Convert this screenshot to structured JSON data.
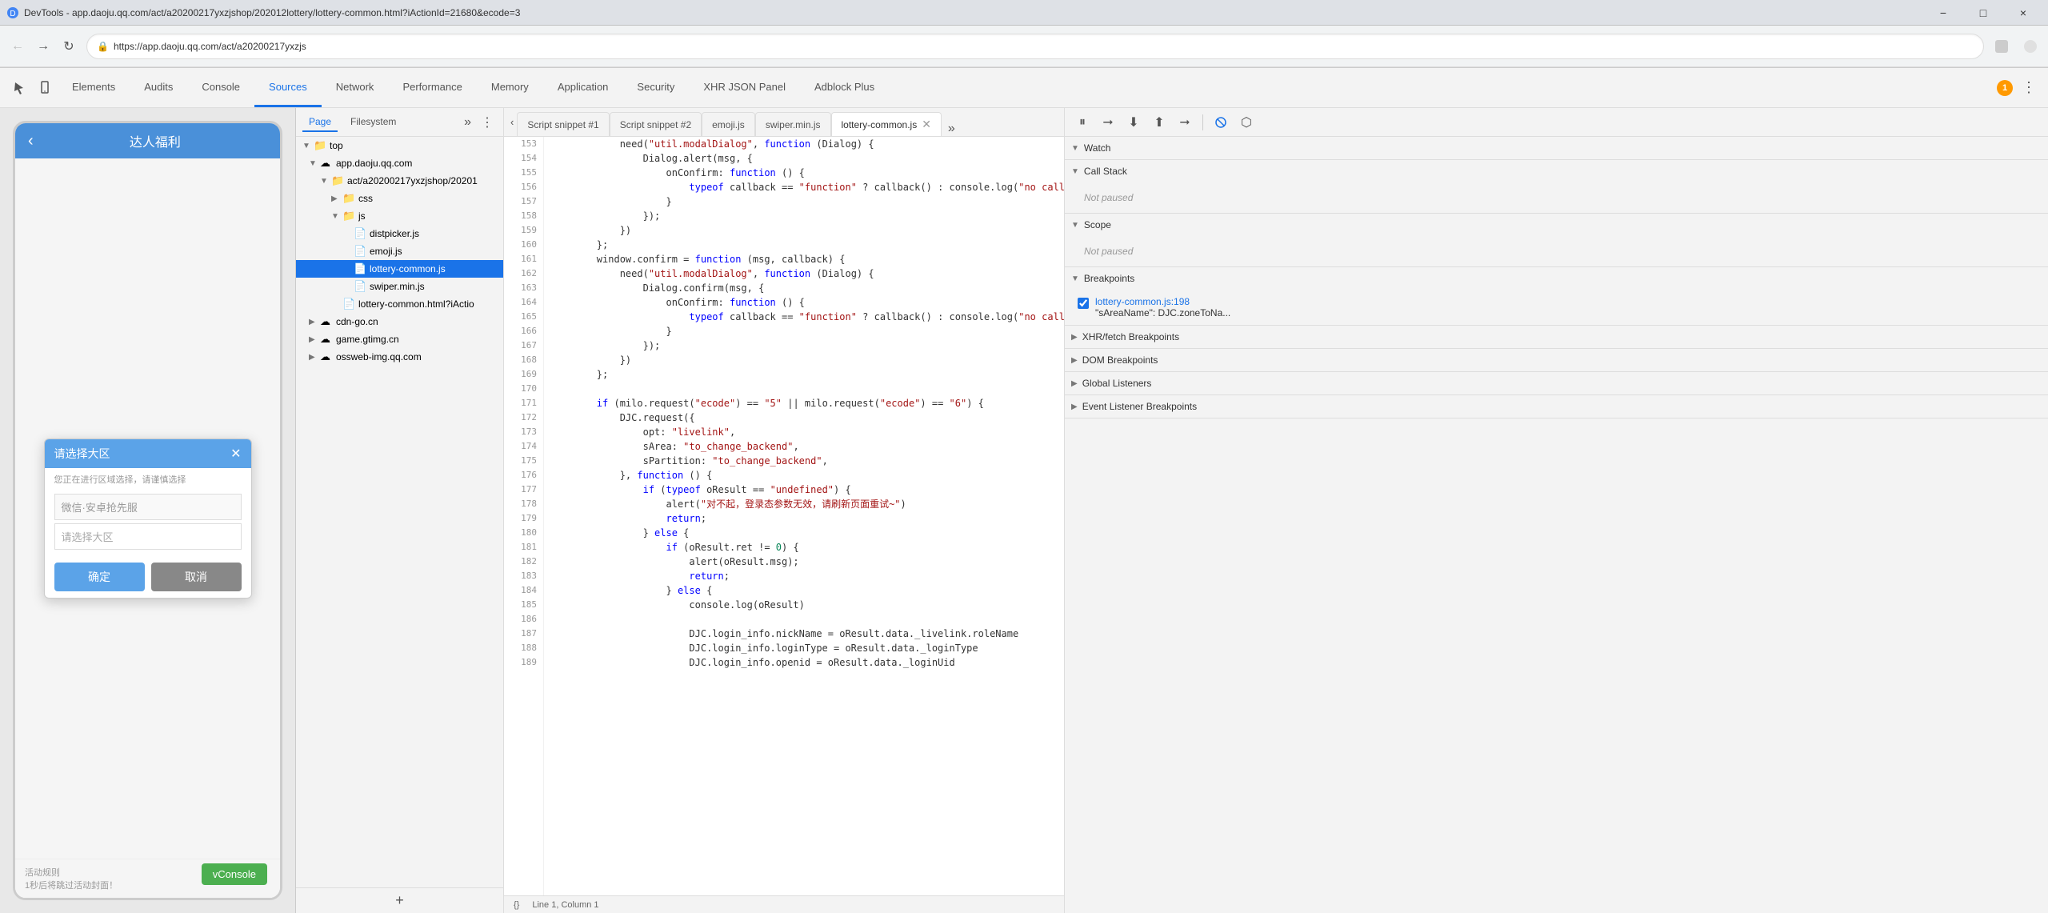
{
  "titlebar": {
    "title": "DevTools - app.daoju.qq.com/act/a20200217yxzjshop/202012lottery/lottery-common.html?iActionId=21680&ecode=3",
    "min": "−",
    "max": "□",
    "close": "×"
  },
  "browser": {
    "url": "https://app.daoju.qq.com/act/a20200217yxzjs",
    "lock_icon": "🔒"
  },
  "devtools": {
    "tabs": [
      {
        "label": "Elements",
        "active": false
      },
      {
        "label": "Audits",
        "active": false
      },
      {
        "label": "Console",
        "active": false
      },
      {
        "label": "Sources",
        "active": true
      },
      {
        "label": "Network",
        "active": false
      },
      {
        "label": "Performance",
        "active": false
      },
      {
        "label": "Memory",
        "active": false
      },
      {
        "label": "Application",
        "active": false
      },
      {
        "label": "Security",
        "active": false
      },
      {
        "label": "XHR JSON Panel",
        "active": false
      },
      {
        "label": "Adblock Plus",
        "active": false
      }
    ],
    "warning_count": "1"
  },
  "phone": {
    "title": "达人福利",
    "dialog": {
      "title": "请选择大区",
      "subtitle": "您正在进行区域选择，请谨慎选择",
      "select1_placeholder": "微信·安卓抢先服",
      "select2_placeholder": "请选择大区",
      "confirm_btn": "确定",
      "cancel_btn": "取消"
    },
    "footer_text": "活动规则",
    "footer_sub": "1秒后将跳过活动封面！",
    "vconsole": "vConsole"
  },
  "sources": {
    "tabs": [
      "Page",
      "Filesystem"
    ],
    "active_tab": "Page",
    "tree": {
      "root": "top",
      "items": [
        {
          "level": 0,
          "type": "folder",
          "label": "top",
          "expanded": true,
          "arrow": "▼"
        },
        {
          "level": 1,
          "type": "cloud",
          "label": "app.daoju.qq.com",
          "expanded": true,
          "arrow": "▼"
        },
        {
          "level": 2,
          "type": "folder",
          "label": "act/a20200217yxzjshop/20201",
          "expanded": true,
          "arrow": "▼"
        },
        {
          "level": 3,
          "type": "folder",
          "label": "css",
          "expanded": false,
          "arrow": "▶"
        },
        {
          "level": 3,
          "type": "folder",
          "label": "js",
          "expanded": true,
          "arrow": "▼"
        },
        {
          "level": 4,
          "type": "file-js",
          "label": "distpicker.js",
          "arrow": ""
        },
        {
          "level": 4,
          "type": "file-js",
          "label": "emoji.js",
          "arrow": ""
        },
        {
          "level": 4,
          "type": "file-js",
          "label": "lottery-common.js",
          "arrow": "",
          "selected": true
        },
        {
          "level": 4,
          "type": "file-js",
          "label": "swiper.min.js",
          "arrow": ""
        },
        {
          "level": 3,
          "type": "file-html",
          "label": "lottery-common.html?iActio",
          "arrow": ""
        },
        {
          "level": 1,
          "type": "cloud",
          "label": "cdn-go.cn",
          "expanded": false,
          "arrow": "▶"
        },
        {
          "level": 1,
          "type": "cloud",
          "label": "game.gtimg.cn",
          "expanded": false,
          "arrow": "▶"
        },
        {
          "level": 1,
          "type": "cloud",
          "label": "ossweb-img.qq.com",
          "expanded": false,
          "arrow": "▶"
        }
      ]
    }
  },
  "editor": {
    "tabs": [
      {
        "label": "Script snippet #1",
        "active": false,
        "closable": false
      },
      {
        "label": "Script snippet #2",
        "active": false,
        "closable": false
      },
      {
        "label": "emoji.js",
        "active": false,
        "closable": false
      },
      {
        "label": "swiper.min.js",
        "active": false,
        "closable": false
      },
      {
        "label": "lottery-common.js",
        "active": true,
        "closable": true
      }
    ],
    "code_lines": [
      {
        "num": "153",
        "code": "            need(\"util.modalDialog\", function (Dialog) {"
      },
      {
        "num": "154",
        "code": "                Dialog.alert(msg, {"
      },
      {
        "num": "155",
        "code": "                    onConfirm: function () {"
      },
      {
        "num": "156",
        "code": "                        typeof callback == \"function\" ? callback() : console.log(\"no callback"
      },
      {
        "num": "157",
        "code": "                    }"
      },
      {
        "num": "158",
        "code": "                });"
      },
      {
        "num": "159",
        "code": "            })"
      },
      {
        "num": "160",
        "code": "        };"
      },
      {
        "num": "161",
        "code": "        window.confirm = function (msg, callback) {"
      },
      {
        "num": "162",
        "code": "            need(\"util.modalDialog\", function (Dialog) {"
      },
      {
        "num": "163",
        "code": "                Dialog.confirm(msg, {"
      },
      {
        "num": "164",
        "code": "                    onConfirm: function () {"
      },
      {
        "num": "165",
        "code": "                        typeof callback == \"function\" ? callback() : console.log(\"no callback"
      },
      {
        "num": "166",
        "code": "                    }"
      },
      {
        "num": "167",
        "code": "                });"
      },
      {
        "num": "168",
        "code": "            })"
      },
      {
        "num": "169",
        "code": "        };"
      },
      {
        "num": "170",
        "code": ""
      },
      {
        "num": "171",
        "code": "        if (milo.request(\"ecode\") == \"5\" || milo.request(\"ecode\") == \"6\") {"
      },
      {
        "num": "172",
        "code": "            DJC.request({"
      },
      {
        "num": "173",
        "code": "                opt: \"livelink\","
      },
      {
        "num": "174",
        "code": "                sArea: \"to_change_backend\","
      },
      {
        "num": "175",
        "code": "                sPartition: \"to_change_backend\","
      },
      {
        "num": "176",
        "code": "            }, function () {"
      },
      {
        "num": "177",
        "code": "                if (typeof oResult == \"undefined\") {"
      },
      {
        "num": "178",
        "code": "                    alert(\"对不起，登录态参数无效，请刷新页面重试~\")"
      },
      {
        "num": "179",
        "code": "                    return;"
      },
      {
        "num": "180",
        "code": "                } else {"
      },
      {
        "num": "181",
        "code": "                    if (oResult.ret != 0) {"
      },
      {
        "num": "182",
        "code": "                        alert(oResult.msg);"
      },
      {
        "num": "183",
        "code": "                        return;"
      },
      {
        "num": "184",
        "code": "                    } else {"
      },
      {
        "num": "185",
        "code": "                        console.log(oResult)"
      },
      {
        "num": "186",
        "code": ""
      },
      {
        "num": "187",
        "code": "                        DJC.login_info.nickName = oResult.data._livelink.roleName"
      },
      {
        "num": "188",
        "code": "                        DJC.login_info.loginType = oResult.data._loginType"
      },
      {
        "num": "189",
        "code": "                        DJC.login_info.openid = oResult.data._loginUid"
      }
    ],
    "status": "Line 1, Column 1"
  },
  "debugger": {
    "toolbar_btns": [
      {
        "icon": "⏸",
        "label": "pause",
        "title": "Pause script execution"
      },
      {
        "icon": "⏭",
        "label": "step-over",
        "title": "Step over next function call"
      },
      {
        "icon": "⬇",
        "label": "step-into",
        "title": "Step into next function call"
      },
      {
        "icon": "⬆",
        "label": "step-out",
        "title": "Step out of current function"
      },
      {
        "icon": "▶",
        "label": "continue",
        "title": "Resume script execution"
      }
    ],
    "sections": [
      {
        "title": "Watch",
        "expanded": true,
        "arrow": "▼",
        "content": null
      },
      {
        "title": "Call Stack",
        "expanded": true,
        "arrow": "▼",
        "content": "Not paused"
      },
      {
        "title": "Scope",
        "expanded": true,
        "arrow": "▼",
        "content": "Not paused"
      },
      {
        "title": "Breakpoints",
        "expanded": true,
        "arrow": "▼",
        "breakpoints": [
          {
            "file": "lottery-common.js:198",
            "detail": "\"sAreaName\": DJC.zoneToNa..."
          }
        ]
      },
      {
        "title": "XHR/fetch Breakpoints",
        "expanded": false,
        "arrow": "▶"
      },
      {
        "title": "DOM Breakpoints",
        "expanded": false,
        "arrow": "▶"
      },
      {
        "title": "Global Listeners",
        "expanded": false,
        "arrow": "▶"
      },
      {
        "title": "Event Listener Breakpoints",
        "expanded": false,
        "arrow": "▶"
      }
    ]
  }
}
